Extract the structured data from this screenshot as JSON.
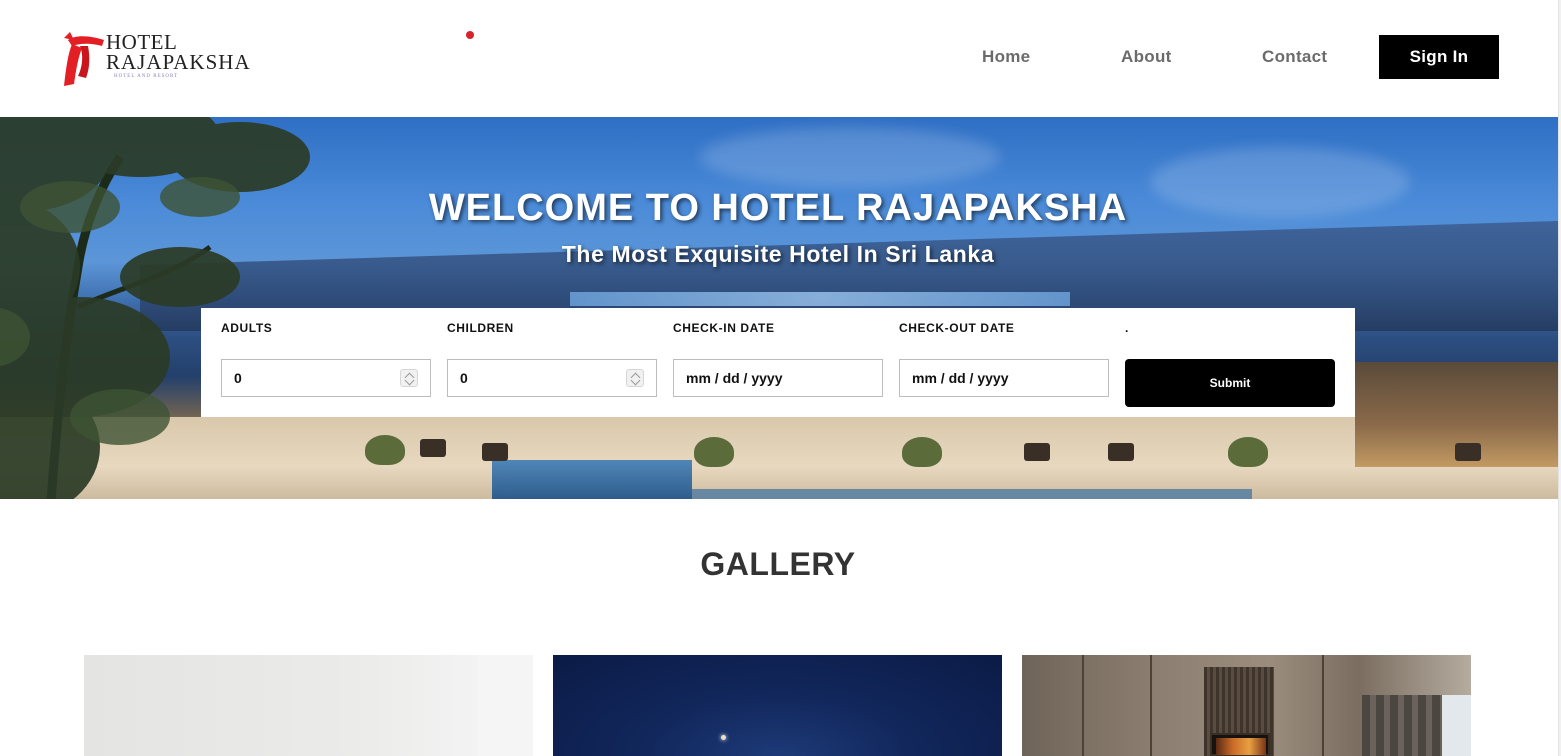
{
  "header": {
    "logo": {
      "line1": "HOTEL",
      "line2": "RAJAPAKSHA",
      "tagline": "HOTEL AND RESORT",
      "icon": "red-scarf-logo-icon",
      "color": "#e41e25"
    },
    "nav": {
      "home": "Home",
      "about": "About",
      "contact": "Contact"
    },
    "sign_in": "Sign In"
  },
  "hero": {
    "title": "WELCOME TO HOTEL RAJAPAKSHA",
    "subtitle": "The Most Exquisite Hotel In Sri Lanka"
  },
  "booking": {
    "adults": {
      "label": "ADULTS",
      "value": "0"
    },
    "children": {
      "label": "CHILDREN",
      "value": "0"
    },
    "check_in": {
      "label": "CHECK-IN DATE",
      "placeholder": "mm / dd / yyyy"
    },
    "check_out": {
      "label": "CHECK-OUT DATE",
      "placeholder": "mm / dd / yyyy"
    },
    "submit_label_caption": ".",
    "submit": "Submit"
  },
  "gallery": {
    "title": "GALLERY"
  },
  "colors": {
    "accent": "#000000",
    "nav_text": "#6b6b6b",
    "logo_red": "#e41e25"
  }
}
